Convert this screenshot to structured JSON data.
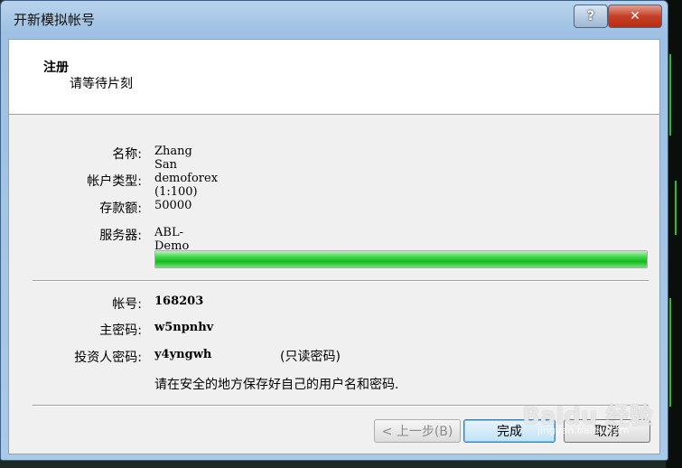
{
  "window": {
    "title": "开新模拟帐号",
    "help_glyph": "?",
    "close_glyph": "✕"
  },
  "header": {
    "title": "注册",
    "subtitle": "请等待片刻"
  },
  "info": {
    "name_label": "名称:",
    "name_value": "Zhang San",
    "type_label": "帐户类型:",
    "type_value": "demoforex (1:100)",
    "deposit_label": "存款额:",
    "deposit_value": "50000",
    "server_label": "服务器:",
    "server_value": "ABL-Demo"
  },
  "progress": {
    "fraction": 1.0,
    "color": "#1fc02a"
  },
  "account": {
    "login_label": "帐号:",
    "login_value": "168203",
    "master_label": "主密码:",
    "master_value": "w5npnhv",
    "investor_label": "投资人密码:",
    "investor_value": "y4yngwh",
    "readonly_note": "(只读密码)",
    "save_note": "请在安全的地方保存好自己的用户名和密码."
  },
  "buttons": {
    "back": "< 上一步(B)",
    "finish": "完成",
    "cancel": "取消"
  },
  "watermark": {
    "text": "Baidu 经验",
    "sub": "jingyan.baidu.com"
  }
}
